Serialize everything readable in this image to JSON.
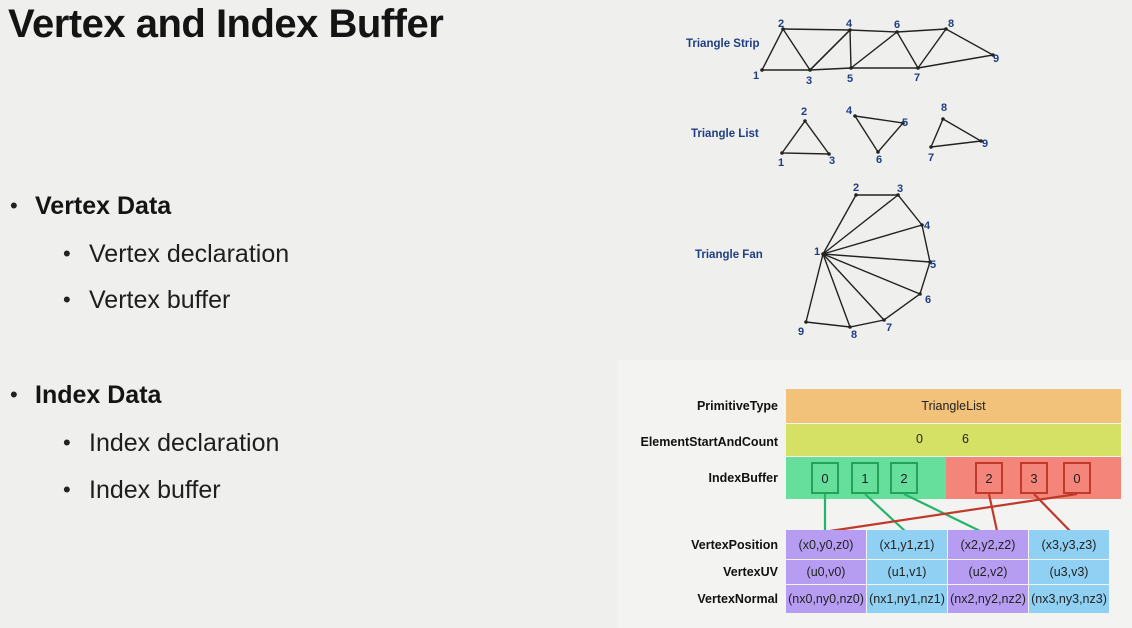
{
  "title": "Vertex and Index Buffer",
  "bullets": {
    "vertex_data": "Vertex Data",
    "vertex_declaration": "Vertex declaration",
    "vertex_buffer": "Vertex buffer",
    "index_data": "Index Data",
    "index_declaration": "Index declaration",
    "index_buffer": "Index buffer"
  },
  "diagrams": {
    "strip_label": "Triangle Strip",
    "list_label": "Triangle List",
    "fan_label": "Triangle Fan"
  },
  "table": {
    "primitive_type_label": "PrimitiveType",
    "primitive_type_value": "TriangleList",
    "element_label": "ElementStartAndCount",
    "element_start": "0",
    "element_count": "6",
    "index_buffer_label": "IndexBuffer",
    "index_values": [
      "0",
      "1",
      "2",
      "2",
      "3",
      "0"
    ],
    "vertex_position_label": "VertexPosition",
    "vertex_positions": [
      "(x0,y0,z0)",
      "(x1,y1,z1)",
      "(x2,y2,z2)",
      "(x3,y3,z3)"
    ],
    "vertex_uv_label": "VertexUV",
    "vertex_uvs": [
      "(u0,v0)",
      "(u1,v1)",
      "(u2,v2)",
      "(u3,v3)"
    ],
    "vertex_normal_label": "VertexNormal",
    "vertex_normals": [
      "(nx0,ny0,nz0)",
      "(nx1,ny1,nz1)",
      "(nx2,ny2,nz2)",
      "(nx3,ny3,nz3)"
    ],
    "colors": {
      "primitive": "#f2c27a",
      "element": "#d4e165",
      "index_green": "#67df9c",
      "index_red": "#f4857a",
      "vertex_purple": "#b79df2",
      "vertex_blue": "#8fd0f3"
    }
  }
}
